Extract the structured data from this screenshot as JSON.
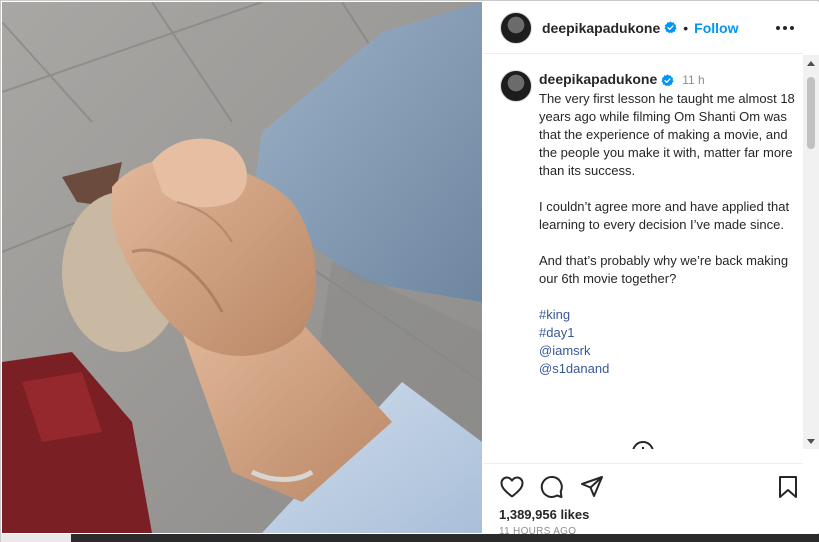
{
  "post": {
    "username": "deepika­padukone",
    "verified_icon": "verified-badge-icon",
    "separator": "•",
    "follow_label": "Follow",
    "more_icon": "more-options-icon"
  },
  "caption": {
    "username": "deepikapadukone",
    "time": "11 h",
    "paragraphs": [
      "The very first lesson he taught me almost 18 years ago while filming Om Shanti Om was that the experience of making a movie, and the people you make it with, matter far more than its success.",
      "I couldn’t agree more and have applied that learning to every decision I’ve made since.",
      "And that’s probably why we’re back making our 6th movie together?"
    ],
    "tags": [
      "#king",
      "#day1",
      "@iamsrk",
      "@s1danand"
    ]
  },
  "actions": {
    "like_icon": "heart-icon",
    "comment_icon": "comment-icon",
    "share_icon": "share-icon",
    "save_icon": "bookmark-icon",
    "add_comment_icon": "add-circle-icon"
  },
  "stats": {
    "likes": "1,389,956 likes",
    "posted_ago": "11 HOURS AGO"
  },
  "colors": {
    "accent": "#0095f6",
    "verified": "#0095f6",
    "hashtag": "#385898"
  }
}
